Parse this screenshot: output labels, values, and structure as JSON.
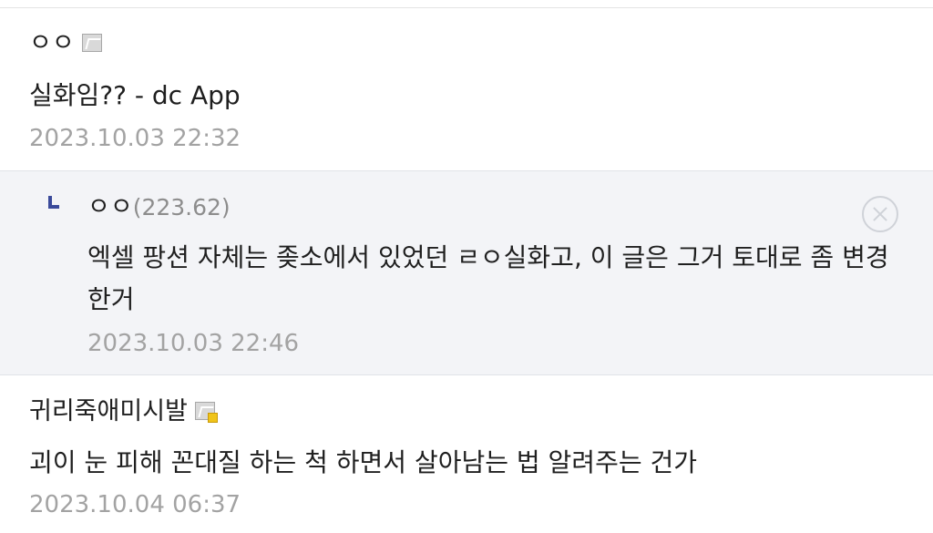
{
  "comments": [
    {
      "nickname": "ㅇㅇ",
      "body": "실화임?? - dc App",
      "date": "2023.10.03 22:32",
      "icon": "gallog-icon"
    },
    {
      "nickname": "ㅇㅇ",
      "ip": "(223.62)",
      "body": "엑셀 팡션 자체는 좆소에서 있었던 ㄹㅇ실화고, 이 글은 그거 토대로 좀 변경한거",
      "date": "2023.10.03 22:46",
      "is_reply": true,
      "reply_icon": "reply-arrow-icon",
      "delete_icon": "close-circle-icon"
    },
    {
      "nickname": "귀리죽애미시발",
      "body": "괴이 눈 피해 꼰대질 하는 척 하면서 살아남는 법 알려주는 건가",
      "date": "2023.10.04 06:37",
      "icon": "gallog-fixed-icon"
    }
  ],
  "colors": {
    "reply_background": "#f3f4f7",
    "date_text": "#a3a3a3",
    "ip_text": "#8d8d8d",
    "reply_arrow": "#3a4a9a"
  }
}
